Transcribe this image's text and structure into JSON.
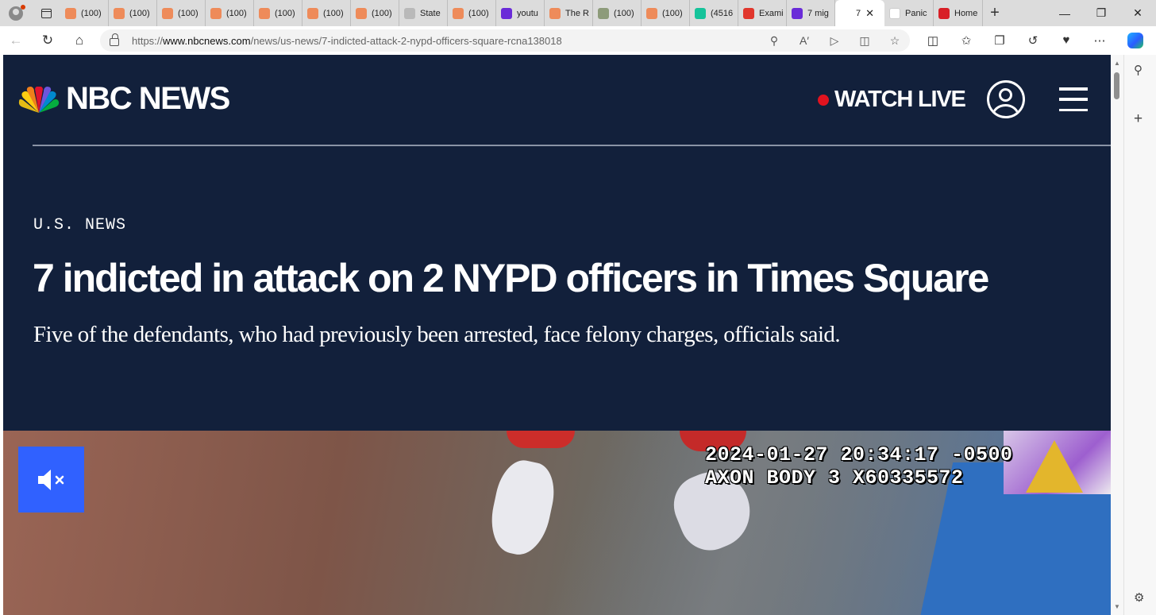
{
  "browser": {
    "tabs": [
      {
        "label": "(100)",
        "favicon": "substack"
      },
      {
        "label": "(100)",
        "favicon": "substack"
      },
      {
        "label": "(100)",
        "favicon": "substack"
      },
      {
        "label": "(100)",
        "favicon": "substack"
      },
      {
        "label": "(100)",
        "favicon": "substack"
      },
      {
        "label": "(100)",
        "favicon": "substack"
      },
      {
        "label": "(100)",
        "favicon": "substack"
      },
      {
        "label": "State",
        "favicon": "shield"
      },
      {
        "label": "(100)",
        "favicon": "substack"
      },
      {
        "label": "youtu",
        "favicon": "yahoo"
      },
      {
        "label": "The R",
        "favicon": "substack"
      },
      {
        "label": "(100)",
        "favicon": "photo"
      },
      {
        "label": "(100)",
        "favicon": "substack"
      },
      {
        "label": "(4516",
        "favicon": "grammarly"
      },
      {
        "label": "Exami",
        "favicon": "youtube"
      },
      {
        "label": "7 mig",
        "favicon": "yahoo"
      },
      {
        "label": "7",
        "favicon": "nbc",
        "active": true
      },
      {
        "label": "Panic",
        "favicon": "pdf"
      },
      {
        "label": "Home",
        "favicon": "red"
      }
    ],
    "new_tab": "+",
    "url_prefix": "https://",
    "url_domain": "www.nbcnews.com",
    "url_path": "/news/us-news/7-indicted-attack-2-nypd-officers-square-rcna138018"
  },
  "site": {
    "brand": "NBC NEWS",
    "watch_live": "WATCH LIVE"
  },
  "article": {
    "section": "U.S. NEWS",
    "headline": "7 indicted in attack on 2 NYPD officers in Times Square",
    "dek": "Five of the defendants, who had previously been arrested, face felony charges, officials said."
  },
  "video": {
    "timestamp": "2024-01-27 20:34:17 -0500",
    "device": "AXON BODY 3 X60335572"
  },
  "colors": {
    "header_bg": "#12203b",
    "live_dot": "#e1131f",
    "mute_button": "#3061ff"
  }
}
